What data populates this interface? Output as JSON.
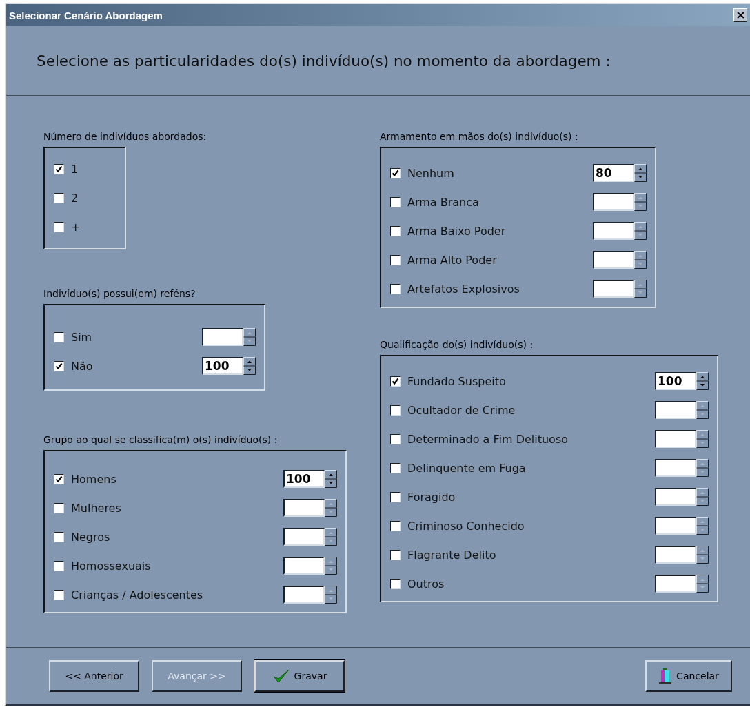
{
  "window": {
    "title": "Selecionar Cenário Abordagem"
  },
  "heading": "Selecione as particularidades do(s) indivíduo(s) no momento da abordagem :",
  "columns": [
    {
      "groups": [
        {
          "label": "Número de indivíduos abordados:",
          "kind": "checklist",
          "items": [
            {
              "label": "1",
              "checked": true
            },
            {
              "label": "2",
              "checked": false
            },
            {
              "label": "+",
              "checked": false
            }
          ]
        },
        {
          "label": "Indivíduo(s) possui(em) reféns?",
          "kind": "spinlist",
          "items": [
            {
              "label": "Sim",
              "checked": false
            },
            {
              "label": "Não",
              "checked": true,
              "value": "100"
            }
          ]
        },
        {
          "label": "Grupo ao qual se classifica(m) o(s) indivíduo(s) :",
          "kind": "spinlist",
          "items": [
            {
              "label": "Homens",
              "checked": true,
              "value": "100"
            },
            {
              "label": "Mulheres",
              "checked": false
            },
            {
              "label": "Negros",
              "checked": false
            },
            {
              "label": "Homossexuais",
              "checked": false
            },
            {
              "label": "Crianças / Adolescentes",
              "checked": false
            }
          ]
        }
      ]
    },
    {
      "groups": [
        {
          "label": "Armamento em mãos do(s) indivíduo(s) :",
          "kind": "spinlist",
          "items": [
            {
              "label": "Nenhum",
              "checked": true,
              "value": "80"
            },
            {
              "label": "Arma Branca",
              "checked": false
            },
            {
              "label": "Arma Baixo Poder",
              "checked": false
            },
            {
              "label": "Arma Alto Poder",
              "checked": false
            },
            {
              "label": "Artefatos Explosivos",
              "checked": false
            }
          ]
        },
        {
          "label": "Qualificação do(s) indivíduo(s) :",
          "kind": "spinlist",
          "items": [
            {
              "label": "Fundado Suspeito",
              "checked": true,
              "value": "100"
            },
            {
              "label": "Ocultador de Crime",
              "checked": false
            },
            {
              "label": "Determinado a Fim Delituoso",
              "checked": false
            },
            {
              "label": "Delinquente em Fuga",
              "checked": false
            },
            {
              "label": "Foragido",
              "checked": false
            },
            {
              "label": "Criminoso Conhecido",
              "checked": false
            },
            {
              "label": "Flagrante Delito",
              "checked": false
            },
            {
              "label": "Outros",
              "checked": false
            }
          ]
        }
      ]
    }
  ],
  "buttons": [
    {
      "label": "<< Anterior",
      "kind": "text",
      "disabled": false,
      "default": false
    },
    {
      "label": "Avançar >>",
      "kind": "text",
      "disabled": true,
      "default": false
    },
    {
      "label": "Gravar",
      "kind": "check",
      "disabled": false,
      "default": true
    },
    {
      "label": "Cancelar",
      "kind": "exit",
      "disabled": false,
      "default": false
    }
  ]
}
